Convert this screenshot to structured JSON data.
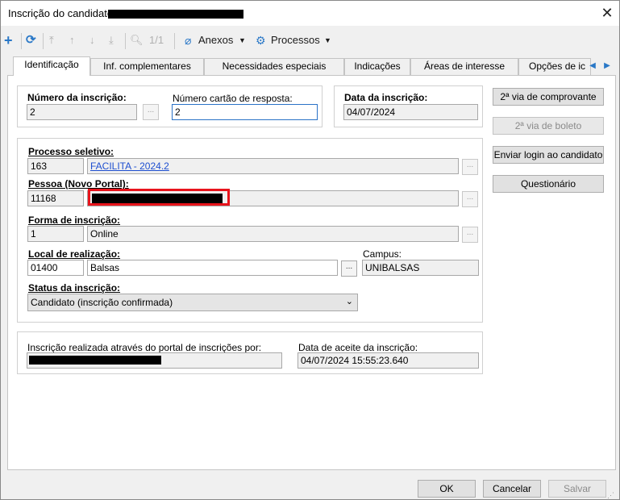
{
  "window": {
    "title": "Inscrição do candidato:",
    "close_glyph": "✕"
  },
  "toolbar": {
    "record_counter": "1/1",
    "anexos_label": "Anexos",
    "processos_label": "Processos",
    "icons": [
      "plus-icon",
      "refresh-icon",
      "first-icon",
      "prev-icon",
      "next-icon",
      "last-icon",
      "search-icon",
      "paperclip-icon",
      "gear-icon"
    ]
  },
  "tabs": [
    "Identificação",
    "Inf. complementares",
    "Necessidades especiais",
    "Indicações",
    "Áreas de interesse",
    "Opções de ic"
  ],
  "fields": {
    "numero_inscricao": {
      "label": "Número da inscrição:",
      "value": "2"
    },
    "numero_cartao": {
      "label": "Número cartão de resposta:",
      "value": "2"
    },
    "data_inscricao": {
      "label": "Data da inscrição:",
      "value": "04/07/2024"
    },
    "processo_seletivo": {
      "label": "Processo seletivo:",
      "code": "163",
      "name": "FACILITA - 2024.2"
    },
    "pessoa": {
      "label": "Pessoa (Novo Portal):",
      "code": "11168",
      "name": ""
    },
    "forma_inscricao": {
      "label": "Forma de inscrição:",
      "code": "1",
      "name": "Online"
    },
    "local_realizacao": {
      "label": "Local de realização:",
      "code": "01400",
      "name": "Balsas"
    },
    "campus": {
      "label": "Campus:",
      "value": "UNIBALSAS"
    },
    "status_inscricao": {
      "label": "Status da inscrição:",
      "value": "Candidato (inscrição confirmada)"
    },
    "realizada_por": {
      "label": "Inscrição realizada através do portal de inscrições por:",
      "value": ""
    },
    "data_aceite": {
      "label": "Data de aceite da inscrição:",
      "value": "04/07/2024 15:55:23.640"
    }
  },
  "side_buttons": {
    "comprovante": "2ª via de comprovante",
    "boleto": "2ª via de boleto",
    "login": "Enviar login ao candidato",
    "questionario": "Questionário"
  },
  "ellipsis": "...",
  "footer": {
    "ok": "OK",
    "cancelar": "Cancelar",
    "salvar": "Salvar"
  },
  "colors": {
    "link": "#1e4fd0",
    "accent": "#2a78c7",
    "highlight_box": "#e8141c"
  }
}
